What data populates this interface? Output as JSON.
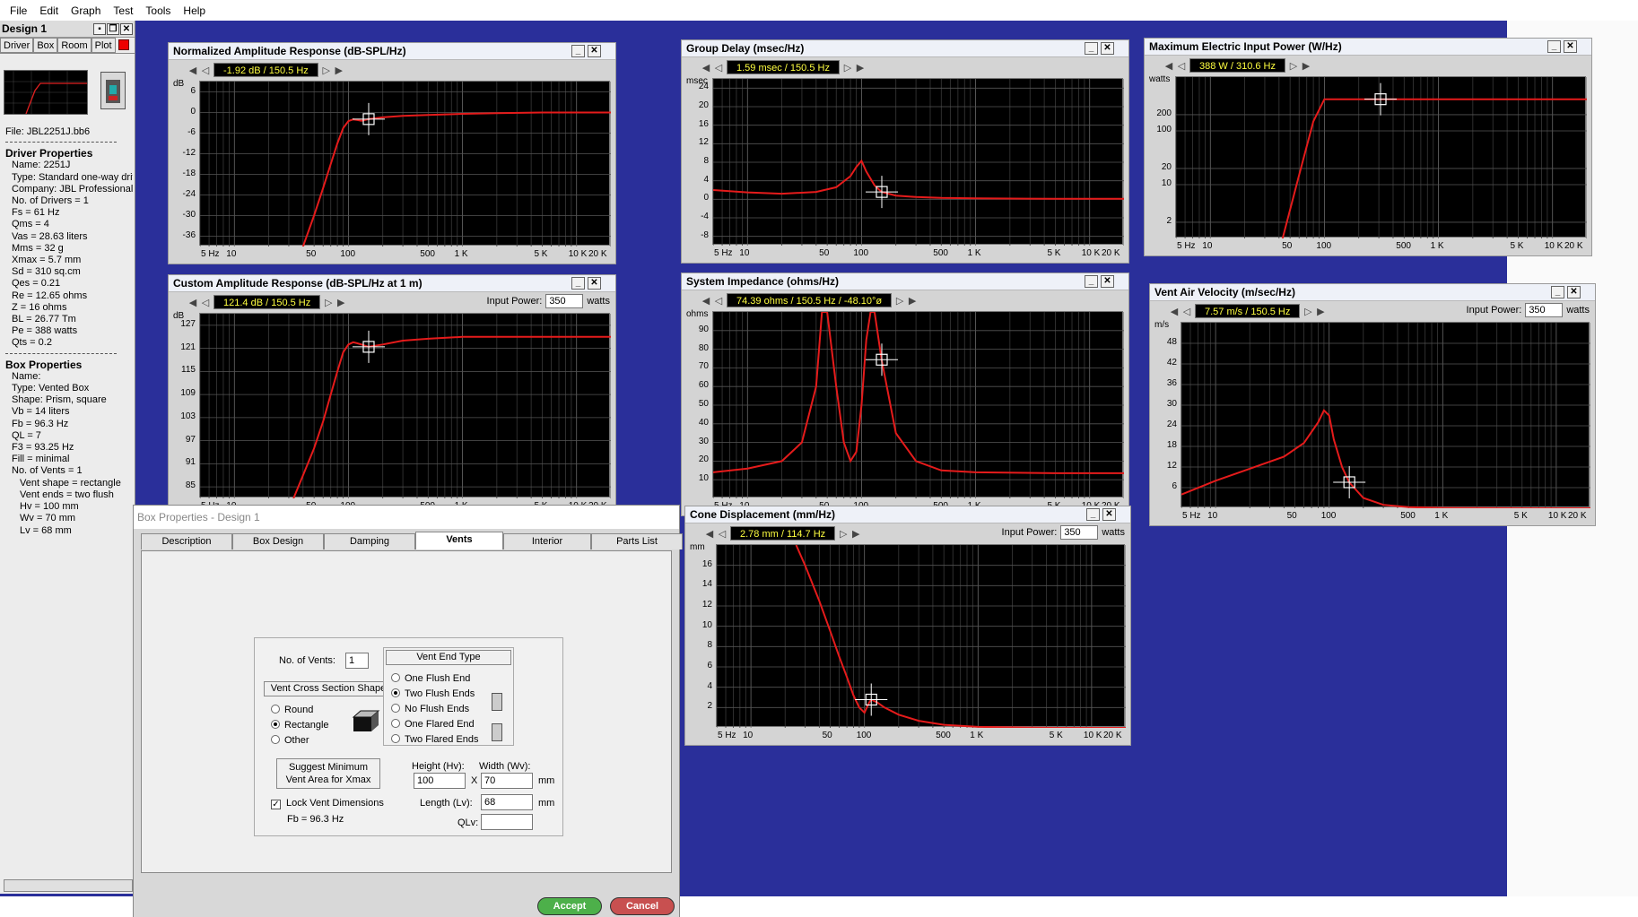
{
  "menu": [
    "File",
    "Edit",
    "Graph",
    "Test",
    "Tools",
    "Help"
  ],
  "side": {
    "title": "Design 1",
    "tabs": [
      "Driver",
      "Box",
      "Room",
      "Plot"
    ],
    "file": "File:  JBL2251J.bb6",
    "driver_header": "Driver Properties",
    "driver": [
      "Name:  2251J",
      "Type:  Standard one-way driver",
      "Company:  JBL Professional Inc.",
      "No. of Drivers = 1",
      "Fs =  61 Hz",
      "Qms =  4",
      "Vas =  28.63 liters",
      "Mms =  32 g",
      "Xmax =  5.7 mm",
      "Sd =  310 sq.cm",
      "Qes =  0.21",
      "Re =  12.65 ohms",
      "Z =  16 ohms",
      "BL =  26.77 Tm",
      "Pe =  388 watts",
      "Qts =  0.2"
    ],
    "box_header": "Box Properties",
    "box": [
      "Name:",
      "Type:  Vented Box",
      "Shape:  Prism, square",
      "Vb =  14 liters",
      "Fb =  96.3 Hz",
      "QL =  7",
      "F3 =  93.25 Hz",
      "Fill =  minimal",
      "No. of Vents = 1",
      "Vent shape = rectangle",
      "Vent ends = two flush",
      "Hv =  100 mm",
      "Wv =  70 mm",
      "Lv =  68 mm"
    ]
  },
  "graphs": {
    "g_norm": {
      "title": "Normalized Amplitude Response (dB-SPL/Hz)",
      "readout": "-1.92 dB / 150.5 Hz",
      "unit": "dB",
      "yticks": [
        "6",
        "0",
        "-6",
        "-12",
        "-18",
        "-24",
        "-30",
        "-36"
      ]
    },
    "g_cust": {
      "title": "Custom Amplitude Response (dB-SPL/Hz at 1 m)",
      "readout": "121.4 dB / 150.5 Hz",
      "unit": "dB",
      "yticks": [
        "127",
        "121",
        "115",
        "109",
        "103",
        "97",
        "91",
        "85"
      ],
      "ip_label": "Input Power:",
      "ip_value": "350",
      "ip_unit": "watts"
    },
    "g_delay": {
      "title": "Group Delay (msec/Hz)",
      "readout": "1.59 msec / 150.5 Hz",
      "unit": "msec",
      "yticks": [
        "24",
        "20",
        "16",
        "12",
        "8",
        "4",
        "0",
        "-4",
        "-8"
      ]
    },
    "g_imp": {
      "title": "System Impedance (ohms/Hz)",
      "readout": "74.39 ohms / 150.5 Hz / -48.10°ø",
      "unit": "ohms",
      "yticks": [
        "90",
        "80",
        "70",
        "60",
        "50",
        "40",
        "30",
        "20",
        "10"
      ]
    },
    "g_cone": {
      "title": "Cone Displacement (mm/Hz)",
      "readout": "2.78 mm / 114.7 Hz",
      "unit": "mm",
      "yticks": [
        "16",
        "14",
        "12",
        "10",
        "8",
        "6",
        "4",
        "2"
      ],
      "ip_label": "Input Power:",
      "ip_value": "350",
      "ip_unit": "watts"
    },
    "g_power": {
      "title": "Maximum Electric Input Power (W/Hz)",
      "readout": "388 W / 310.6 Hz",
      "unit": "watts",
      "yticks": [
        "200",
        "100",
        "20",
        "10",
        "2"
      ]
    },
    "g_vent": {
      "title": "Vent Air Velocity (m/sec/Hz)",
      "readout": "7.57 m/s / 150.5 Hz",
      "unit": "m/s",
      "yticks": [
        "48",
        "42",
        "36",
        "30",
        "24",
        "18",
        "12",
        "6"
      ],
      "ip_label": "Input Power:",
      "ip_value": "350",
      "ip_unit": "watts"
    }
  },
  "xticks": [
    "5 Hz",
    "10",
    "50",
    "100",
    "500",
    "1 K",
    "5 K",
    "10 K",
    "20 K"
  ],
  "chart_data": [
    {
      "type": "line",
      "title": "Normalized Amplitude Response (dB-SPL/Hz)",
      "ylabel": "dB",
      "x_scale": "log",
      "xlim": [
        5,
        20000
      ],
      "ylim": [
        -39,
        9
      ],
      "grid": true,
      "series": [
        {
          "x": [
            40,
            50,
            60,
            70,
            80,
            90,
            100,
            110,
            120,
            130,
            150,
            200,
            300,
            500,
            1000,
            2000,
            5000,
            10000,
            20000
          ],
          "y": [
            -39,
            -30,
            -22,
            -15,
            -9,
            -4.5,
            -2.5,
            -2,
            -2.2,
            -2.4,
            -1.92,
            -1.4,
            -1,
            -0.7,
            -0.4,
            -0.2,
            0,
            0,
            0
          ]
        }
      ]
    },
    {
      "type": "line",
      "title": "Custom Amplitude Response (dB-SPL/Hz at 1 m)",
      "ylabel": "dB",
      "x_scale": "log",
      "xlim": [
        5,
        20000
      ],
      "ylim": [
        82,
        130
      ],
      "grid": true,
      "series": [
        {
          "x": [
            33,
            40,
            50,
            60,
            70,
            80,
            90,
            100,
            110,
            120,
            130,
            150,
            200,
            300,
            500,
            1000,
            2000,
            5000,
            10000,
            20000
          ],
          "y": [
            82,
            88,
            95,
            102,
            109,
            115,
            120,
            122,
            122.6,
            122.3,
            122,
            121.4,
            122,
            123,
            123.5,
            124,
            124,
            124,
            124,
            124
          ]
        }
      ]
    },
    {
      "type": "line",
      "title": "Group Delay (msec/Hz)",
      "ylabel": "msec",
      "x_scale": "log",
      "xlim": [
        5,
        20000
      ],
      "ylim": [
        -10,
        26
      ],
      "grid": true,
      "series": [
        {
          "x": [
            5,
            10,
            20,
            40,
            60,
            80,
            90,
            100,
            110,
            130,
            150,
            200,
            300,
            500,
            1000,
            5000,
            20000
          ],
          "y": [
            2,
            1.5,
            1.2,
            1.6,
            2.6,
            5,
            7,
            8.3,
            6,
            3,
            1.59,
            0.8,
            0.5,
            0.3,
            0.2,
            0.1,
            0.1
          ]
        }
      ]
    },
    {
      "type": "line",
      "title": "System Impedance (ohms/Hz)",
      "ylabel": "ohms",
      "x_scale": "log",
      "xlim": [
        5,
        20000
      ],
      "ylim": [
        0,
        100
      ],
      "grid": true,
      "series": [
        {
          "x": [
            5,
            10,
            20,
            30,
            40,
            45,
            50,
            60,
            70,
            80,
            90,
            100,
            110,
            120,
            130,
            150,
            200,
            300,
            500,
            1000,
            5000,
            20000
          ],
          "y": [
            14,
            16,
            20,
            30,
            60,
            100,
            100,
            60,
            30,
            20,
            25,
            50,
            85,
            100,
            100,
            74.39,
            35,
            20,
            15,
            14,
            13.5,
            13.5
          ]
        }
      ]
    },
    {
      "type": "line",
      "title": "Cone Displacement (mm/Hz)",
      "ylabel": "mm",
      "x_scale": "log",
      "xlim": [
        5,
        20000
      ],
      "ylim": [
        0,
        18
      ],
      "grid": true,
      "series": [
        {
          "x": [
            25,
            30,
            40,
            50,
            60,
            70,
            80,
            90,
            100,
            110,
            114.7,
            130,
            150,
            200,
            300,
            500,
            1000,
            2000,
            5000,
            20000
          ],
          "y": [
            18,
            16,
            12.5,
            9.5,
            7,
            5,
            3.2,
            2,
            1.5,
            2.5,
            2.78,
            2.5,
            2,
            1.3,
            0.7,
            0.3,
            0.1,
            0.05,
            0,
            0
          ]
        }
      ]
    },
    {
      "type": "line",
      "title": "Maximum Electric Input Power (W/Hz)",
      "ylabel": "watts",
      "x_scale": "log",
      "xlim": [
        5,
        20000
      ],
      "ylim": [
        1,
        1000
      ],
      "y_scale": "log",
      "grid": true,
      "series": [
        {
          "x": [
            43,
            60,
            80,
            100,
            150,
            200,
            310.6,
            500,
            1000,
            5000,
            20000
          ],
          "y": [
            1,
            15,
            150,
            388,
            388,
            388,
            388,
            388,
            388,
            388,
            388
          ]
        }
      ]
    },
    {
      "type": "line",
      "title": "Vent Air Velocity (m/sec/Hz)",
      "ylabel": "m/s",
      "x_scale": "log",
      "xlim": [
        5,
        20000
      ],
      "ylim": [
        0,
        54
      ],
      "grid": true,
      "series": [
        {
          "x": [
            5,
            10,
            20,
            40,
            60,
            80,
            90,
            100,
            110,
            130,
            150,
            200,
            300,
            500,
            1000,
            5000,
            20000
          ],
          "y": [
            4,
            8,
            11.5,
            15,
            19,
            25,
            28.5,
            27,
            20,
            12,
            7.57,
            3,
            1,
            0.3,
            0.1,
            0,
            0
          ]
        }
      ]
    }
  ],
  "dialog": {
    "title": "Box Properties - Design 1",
    "tabs": [
      "Description",
      "Box Design",
      "Damping",
      "Vents",
      "Interior",
      "Parts List"
    ],
    "active_tab": "Vents",
    "no_vents_label": "No. of Vents:",
    "no_vents_value": "1",
    "cross_section_title": "Vent Cross Section Shape",
    "shapes": [
      "Round",
      "Rectangle",
      "Other"
    ],
    "shape_selected": "Rectangle",
    "end_type_title": "Vent End Type",
    "ends": [
      "One Flush End",
      "Two Flush Ends",
      "No Flush Ends",
      "One Flared End",
      "Two Flared Ends"
    ],
    "end_selected": "Two Flush Ends",
    "height_label": "Height (Hv):",
    "height_value": "100",
    "width_label": "Width (Wv):",
    "width_value": "70",
    "x_sign": "X",
    "mm": "mm",
    "length_label": "Length (Lv):",
    "length_value": "68",
    "qlv_label": "QLv:",
    "qlv_value": "",
    "suggest_line1": "Suggest Minimum",
    "suggest_line2": "Vent Area for Xmax",
    "lock_label": "Lock Vent Dimensions",
    "fb_text": "Fb = 96.3 Hz",
    "accept": "Accept",
    "cancel": "Cancel"
  }
}
